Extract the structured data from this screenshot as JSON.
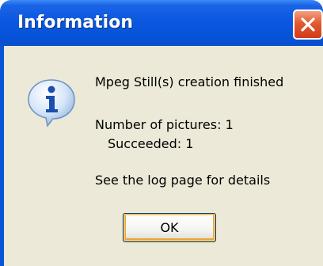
{
  "dialog": {
    "title": "Information",
    "icon": "information-icon",
    "message_lines": [
      "Mpeg Still(s) creation finished",
      "Number of pictures: 1",
      "Succeeded: 1",
      "See the log page for details"
    ],
    "ok_label": "OK"
  },
  "colors": {
    "titlebar": "#0653d8",
    "client_background": "#ece9d8",
    "close_button": "#e35a2f"
  }
}
